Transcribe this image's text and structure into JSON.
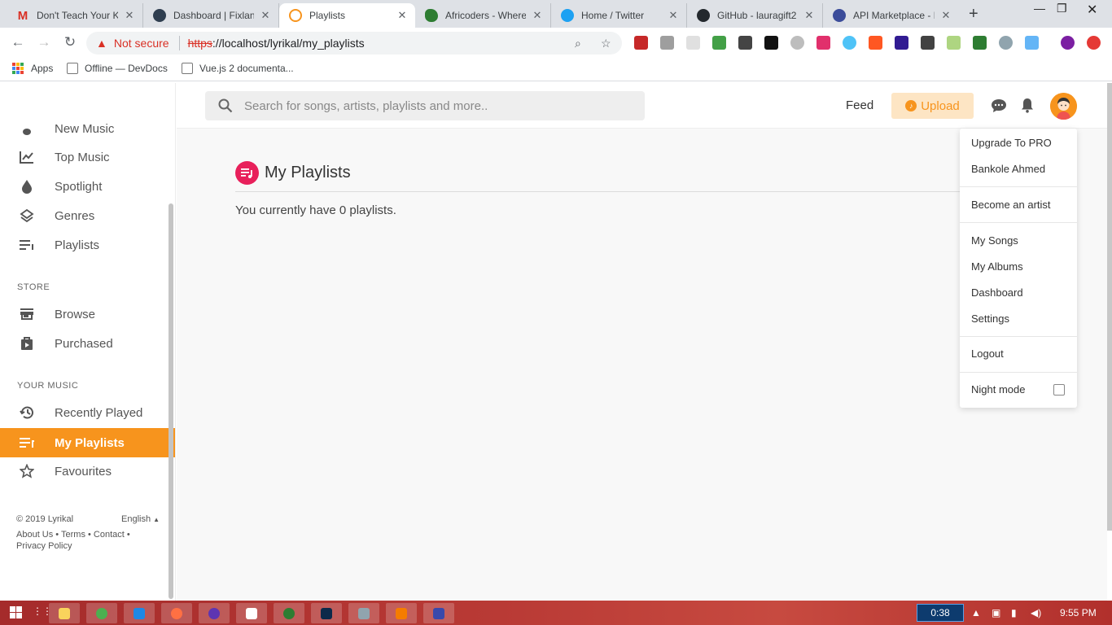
{
  "browser": {
    "tabs": [
      {
        "title": "Don't Teach Your K",
        "favicon_color": "#d93025",
        "favicon_letter": "M"
      },
      {
        "title": "Dashboard | Fixland",
        "favicon_color": "#2f3e50",
        "favicon_letter": ""
      },
      {
        "title": "Playlists",
        "favicon_color": "#f7941d",
        "favicon_letter": ""
      },
      {
        "title": "Africoders - Where",
        "favicon_color": "#2e7d32",
        "favicon_letter": ""
      },
      {
        "title": "Home / Twitter",
        "favicon_color": "#1da1f2",
        "favicon_letter": ""
      },
      {
        "title": "GitHub - lauragift2",
        "favicon_color": "#24292e",
        "favicon_letter": ""
      },
      {
        "title": "API Marketplace - F",
        "favicon_color": "#3b4c9a",
        "favicon_letter": ""
      }
    ],
    "url": {
      "security_label": "Not secure",
      "scheme": "https",
      "rest": "://localhost/lyrikal/my_playlists"
    },
    "bookmarks": [
      "Apps",
      "Offline — DevDocs",
      "Vue.js 2 documenta..."
    ]
  },
  "sidebar": {
    "top_items": [
      {
        "label": "New Music",
        "icon": "music-note-icon"
      },
      {
        "label": "Top Music",
        "icon": "trending-icon"
      },
      {
        "label": "Spotlight",
        "icon": "drop-icon"
      },
      {
        "label": "Genres",
        "icon": "layers-icon"
      },
      {
        "label": "Playlists",
        "icon": "playlist-icon"
      }
    ],
    "store_label": "STORE",
    "store_items": [
      {
        "label": "Browse",
        "icon": "store-icon"
      },
      {
        "label": "Purchased",
        "icon": "bag-icon"
      }
    ],
    "your_music_label": "YOUR MUSIC",
    "your_music_items": [
      {
        "label": "Recently Played",
        "icon": "history-icon"
      },
      {
        "label": "My Playlists",
        "icon": "playlist-icon",
        "active": true
      },
      {
        "label": "Favourites",
        "icon": "star-icon"
      }
    ],
    "footer": {
      "copyright": "© 2019 Lyrikal",
      "language": "English",
      "links_line1": "About Us • Terms • Contact •",
      "links_line2": "Privacy Policy"
    }
  },
  "header": {
    "search_placeholder": "Search for songs, artists, playlists and more..",
    "feed_label": "Feed",
    "upload_label": "Upload"
  },
  "main": {
    "title": "My Playlists",
    "message": "You currently have 0 playlists."
  },
  "dropdown": {
    "upgrade": "Upgrade To PRO",
    "user_name": "Bankole Ahmed",
    "become_artist": "Become an artist",
    "my_songs": "My Songs",
    "my_albums": "My Albums",
    "dashboard": "Dashboard",
    "settings": "Settings",
    "logout": "Logout",
    "night_mode": "Night mode"
  },
  "taskbar": {
    "timer": "0:38",
    "clock": "9:55 PM"
  },
  "colors": {
    "accent": "#f7941d",
    "playlist_badge": "#e8205b"
  }
}
